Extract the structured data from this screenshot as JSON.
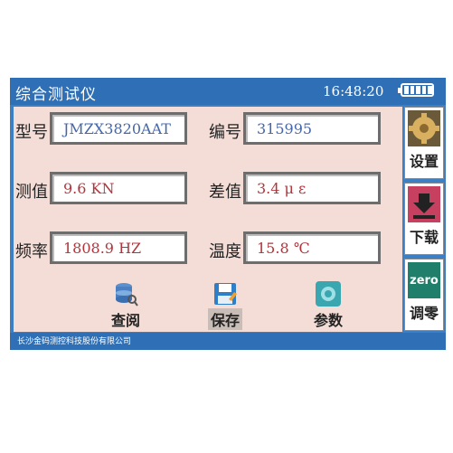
{
  "header": {
    "title": "综合测试仪",
    "time": "16:48:20"
  },
  "fields": [
    {
      "label": "型号",
      "value": "JMZX3820AAT"
    },
    {
      "label": "编号",
      "value": "315995"
    },
    {
      "label": "测值",
      "value": "9.6  KN"
    },
    {
      "label": "差值",
      "value": "3.4 μ  ε"
    },
    {
      "label": "频率",
      "value": "1808.9  HZ"
    },
    {
      "label": "温度",
      "value": "15.8  ℃"
    }
  ],
  "toolbar": {
    "query": "查阅",
    "save": "保存",
    "params": "参数"
  },
  "side": {
    "settings": "设置",
    "download": "下载",
    "zero_icon": "zero",
    "zero": "调零"
  },
  "footer": {
    "company": "长沙金码测控科技股份有限公司"
  },
  "colors": {
    "title_bar": "#2f6fb5",
    "panel": "#f4ddd7",
    "value_blue": "#4466aa",
    "value_red": "#b2343a"
  }
}
